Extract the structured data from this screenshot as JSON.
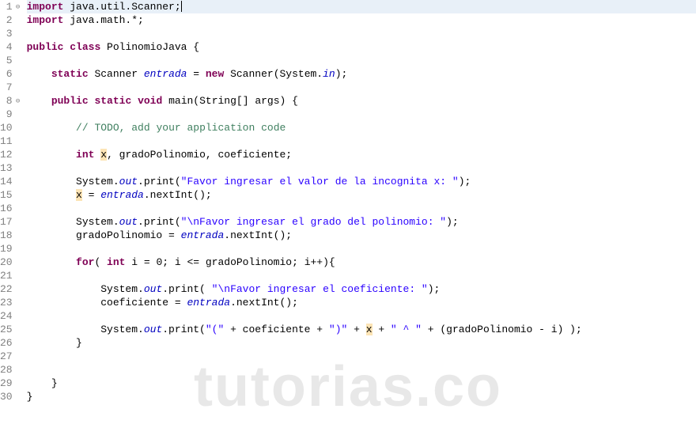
{
  "watermark": "tutorias.co",
  "lines": [
    {
      "num": 1,
      "fold": "⊖",
      "highlight": true,
      "tokens": [
        {
          "t": "import",
          "c": "kw"
        },
        {
          "t": " java.util.Scanner;",
          "c": "normal"
        }
      ],
      "cursor": true
    },
    {
      "num": 2,
      "fold": "",
      "tokens": [
        {
          "t": "import",
          "c": "kw"
        },
        {
          "t": " java.math.*;",
          "c": "normal"
        }
      ]
    },
    {
      "num": 3,
      "fold": "",
      "tokens": []
    },
    {
      "num": 4,
      "fold": "",
      "tokens": [
        {
          "t": "public",
          "c": "kw"
        },
        {
          "t": " ",
          "c": "normal"
        },
        {
          "t": "class",
          "c": "kw"
        },
        {
          "t": " PolinomioJava {",
          "c": "normal"
        }
      ]
    },
    {
      "num": 5,
      "fold": "",
      "tokens": []
    },
    {
      "num": 6,
      "fold": "",
      "tokens": [
        {
          "t": "    ",
          "c": "normal"
        },
        {
          "t": "static",
          "c": "kw"
        },
        {
          "t": " Scanner ",
          "c": "normal"
        },
        {
          "t": "entrada",
          "c": "field"
        },
        {
          "t": " = ",
          "c": "normal"
        },
        {
          "t": "new",
          "c": "kw"
        },
        {
          "t": " Scanner(System.",
          "c": "normal"
        },
        {
          "t": "in",
          "c": "field"
        },
        {
          "t": ");",
          "c": "normal"
        }
      ]
    },
    {
      "num": 7,
      "fold": "",
      "tokens": []
    },
    {
      "num": 8,
      "fold": "⊖",
      "tokens": [
        {
          "t": "    ",
          "c": "normal"
        },
        {
          "t": "public",
          "c": "kw"
        },
        {
          "t": " ",
          "c": "normal"
        },
        {
          "t": "static",
          "c": "kw"
        },
        {
          "t": " ",
          "c": "normal"
        },
        {
          "t": "void",
          "c": "kw"
        },
        {
          "t": " main(String[] args) {",
          "c": "normal"
        }
      ]
    },
    {
      "num": 9,
      "fold": "",
      "tokens": []
    },
    {
      "num": 10,
      "fold": "",
      "tokens": [
        {
          "t": "        ",
          "c": "normal"
        },
        {
          "t": "// ",
          "c": "comment"
        },
        {
          "t": "TODO",
          "c": "comment"
        },
        {
          "t": ", add your application code",
          "c": "comment"
        }
      ]
    },
    {
      "num": 11,
      "fold": "",
      "tokens": []
    },
    {
      "num": 12,
      "fold": "",
      "tokens": [
        {
          "t": "        ",
          "c": "normal"
        },
        {
          "t": "int",
          "c": "kw"
        },
        {
          "t": " ",
          "c": "normal"
        },
        {
          "t": "x",
          "c": "warn-bg"
        },
        {
          "t": ", gradoPolinomio, coeficiente;",
          "c": "normal"
        }
      ]
    },
    {
      "num": 13,
      "fold": "",
      "tokens": []
    },
    {
      "num": 14,
      "fold": "",
      "tokens": [
        {
          "t": "        System.",
          "c": "normal"
        },
        {
          "t": "out",
          "c": "field"
        },
        {
          "t": ".print(",
          "c": "normal"
        },
        {
          "t": "\"Favor ingresar el valor de la incognita x: \"",
          "c": "str"
        },
        {
          "t": ");",
          "c": "normal"
        }
      ]
    },
    {
      "num": 15,
      "fold": "",
      "tokens": [
        {
          "t": "        ",
          "c": "normal"
        },
        {
          "t": "x",
          "c": "warn-bg"
        },
        {
          "t": " = ",
          "c": "normal"
        },
        {
          "t": "entrada",
          "c": "field"
        },
        {
          "t": ".nextInt();",
          "c": "normal"
        }
      ]
    },
    {
      "num": 16,
      "fold": "",
      "tokens": []
    },
    {
      "num": 17,
      "fold": "",
      "tokens": [
        {
          "t": "        System.",
          "c": "normal"
        },
        {
          "t": "out",
          "c": "field"
        },
        {
          "t": ".print(",
          "c": "normal"
        },
        {
          "t": "\"\\nFavor ingresar el grado del polinomio: \"",
          "c": "str"
        },
        {
          "t": ");",
          "c": "normal"
        }
      ]
    },
    {
      "num": 18,
      "fold": "",
      "tokens": [
        {
          "t": "        gradoPolinomio = ",
          "c": "normal"
        },
        {
          "t": "entrada",
          "c": "field"
        },
        {
          "t": ".nextInt();",
          "c": "normal"
        }
      ]
    },
    {
      "num": 19,
      "fold": "",
      "tokens": []
    },
    {
      "num": 20,
      "fold": "",
      "tokens": [
        {
          "t": "        ",
          "c": "normal"
        },
        {
          "t": "for",
          "c": "kw"
        },
        {
          "t": "( ",
          "c": "normal"
        },
        {
          "t": "int",
          "c": "kw"
        },
        {
          "t": " i = 0; i <= gradoPolinomio; i++){",
          "c": "normal"
        }
      ]
    },
    {
      "num": 21,
      "fold": "",
      "tokens": []
    },
    {
      "num": 22,
      "fold": "",
      "tokens": [
        {
          "t": "            System.",
          "c": "normal"
        },
        {
          "t": "out",
          "c": "field"
        },
        {
          "t": ".print( ",
          "c": "normal"
        },
        {
          "t": "\"\\nFavor ingresar el coeficiente: \"",
          "c": "str"
        },
        {
          "t": ");",
          "c": "normal"
        }
      ]
    },
    {
      "num": 23,
      "fold": "",
      "tokens": [
        {
          "t": "            coeficiente = ",
          "c": "normal"
        },
        {
          "t": "entrada",
          "c": "field"
        },
        {
          "t": ".nextInt();",
          "c": "normal"
        }
      ]
    },
    {
      "num": 24,
      "fold": "",
      "tokens": []
    },
    {
      "num": 25,
      "fold": "",
      "tokens": [
        {
          "t": "            System.",
          "c": "normal"
        },
        {
          "t": "out",
          "c": "field"
        },
        {
          "t": ".print(",
          "c": "normal"
        },
        {
          "t": "\"(\"",
          "c": "str"
        },
        {
          "t": " + coeficiente + ",
          "c": "normal"
        },
        {
          "t": "\")\"",
          "c": "str"
        },
        {
          "t": " + ",
          "c": "normal"
        },
        {
          "t": "x",
          "c": "warn-bg"
        },
        {
          "t": " + ",
          "c": "normal"
        },
        {
          "t": "\" ^ \"",
          "c": "str"
        },
        {
          "t": " + (gradoPolinomio - i) );",
          "c": "normal"
        }
      ]
    },
    {
      "num": 26,
      "fold": "",
      "tokens": [
        {
          "t": "        }",
          "c": "normal"
        }
      ]
    },
    {
      "num": 27,
      "fold": "",
      "tokens": []
    },
    {
      "num": 28,
      "fold": "",
      "tokens": []
    },
    {
      "num": 29,
      "fold": "",
      "tokens": [
        {
          "t": "    }",
          "c": "normal"
        }
      ]
    },
    {
      "num": 30,
      "fold": "",
      "tokens": [
        {
          "t": "}",
          "c": "normal"
        }
      ]
    }
  ]
}
